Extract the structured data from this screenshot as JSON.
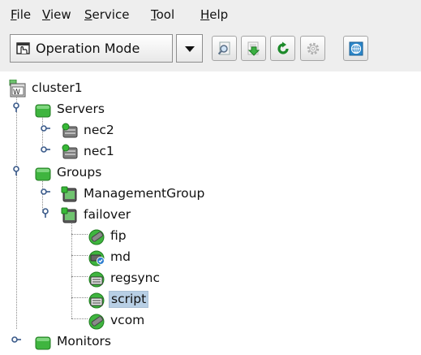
{
  "menu": {
    "file": {
      "mnemonic": "F",
      "rest": "ile"
    },
    "view": {
      "mnemonic": "V",
      "rest": "iew"
    },
    "service": {
      "mnemonic": "S",
      "rest": "ervice"
    },
    "tool": {
      "mnemonic": "T",
      "rest": "ool"
    },
    "help": {
      "mnemonic": "H",
      "rest": "elp"
    }
  },
  "toolbar": {
    "mode_label": "Operation Mode"
  },
  "tree": {
    "cluster": "cluster1",
    "servers": "Servers",
    "server_nec2": "nec2",
    "server_nec1": "nec1",
    "groups": "Groups",
    "group_management": "ManagementGroup",
    "group_failover": "failover",
    "res_fip": "fip",
    "res_md": "md",
    "res_regsync": "regsync",
    "res_script": "script",
    "res_vcom": "vcom",
    "monitors": "Monitors"
  },
  "colors": {
    "selection": "#b8cfe5",
    "status_green": "#2fae2f"
  }
}
